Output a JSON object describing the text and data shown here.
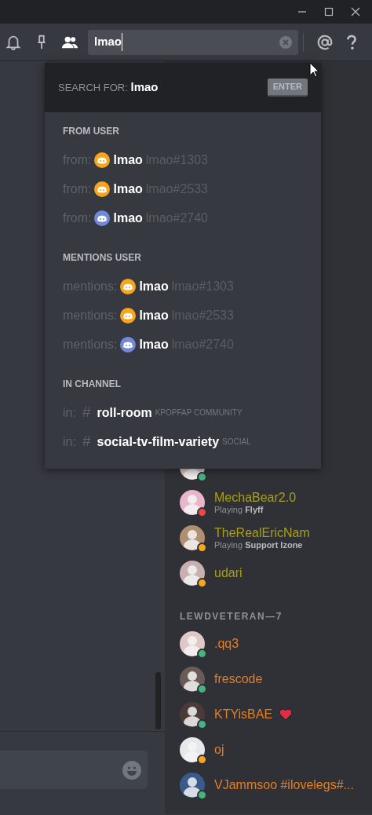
{
  "window": {
    "controls": [
      {
        "kind": "minimize"
      },
      {
        "kind": "maximize"
      },
      {
        "kind": "close"
      }
    ]
  },
  "toolbar": {
    "icons": [
      {
        "kind": "bell",
        "selected": false
      },
      {
        "kind": "pin",
        "selected": false
      },
      {
        "kind": "members",
        "selected": true
      }
    ],
    "search": {
      "value": "lmao"
    },
    "right_icons": [
      {
        "kind": "mention"
      },
      {
        "kind": "help"
      }
    ]
  },
  "search_popup": {
    "search_for_label": "SEARCH FOR:",
    "query": "lmao",
    "enter_key": "ENTER",
    "sections": [
      {
        "title": "FROM USER",
        "items": [
          {
            "kind": "user",
            "prefix": "from:",
            "name": "lmao",
            "tag": "lmao#1303",
            "color": "#f8a51c"
          },
          {
            "kind": "user",
            "prefix": "from:",
            "name": "lmao",
            "tag": "lmao#2533",
            "color": "#f8a51c"
          },
          {
            "kind": "user",
            "prefix": "from:",
            "name": "lmao",
            "tag": "lmao#2740",
            "color": "#7289da"
          }
        ]
      },
      {
        "title": "MENTIONS USER",
        "items": [
          {
            "kind": "user",
            "prefix": "mentions:",
            "name": "lmao",
            "tag": "lmao#1303",
            "color": "#f8a51c"
          },
          {
            "kind": "user",
            "prefix": "mentions:",
            "name": "lmao",
            "tag": "lmao#2533",
            "color": "#f8a51c"
          },
          {
            "kind": "user",
            "prefix": "mentions:",
            "name": "lmao",
            "tag": "lmao#2740",
            "color": "#7289da"
          }
        ]
      },
      {
        "title": "IN CHANNEL",
        "items": [
          {
            "kind": "channel",
            "prefix": "in:",
            "hash": "#",
            "name": "roll-room",
            "server": "KPOPFAP COMMUNITY"
          },
          {
            "kind": "channel",
            "prefix": "in:",
            "hash": "#",
            "name": "social-tv-film-variety",
            "server": "SOCIAL"
          }
        ]
      }
    ]
  },
  "member_groups": [
    {
      "color": "#a8a012",
      "members": [
        {
          "color": "#43b581"
        },
        {
          "name": "MechaBear2.0",
          "color": "#f04747",
          "activity": "Playing **Flyff**"
        },
        {
          "name": "TheRealEricNam",
          "color": "#faa61a",
          "activity": "Playing **Support Izone**"
        },
        {
          "name": "udari",
          "color": "#faa61a"
        }
      ]
    },
    {
      "title": "LEWDVETERAN—7",
      "color": "#e67e22",
      "members": [
        {
          "name": ".qq3",
          "color": "#43b581"
        },
        {
          "name": "frescode",
          "color": "#43b581"
        },
        {
          "name": "KTYisBAE",
          "color": "#43b581",
          "heart_emoji": true
        },
        {
          "name": "oj",
          "color": "#faa61a"
        },
        {
          "name": "VJammsoo #ilovelegs#...",
          "color": "#43b581"
        }
      ]
    }
  ]
}
